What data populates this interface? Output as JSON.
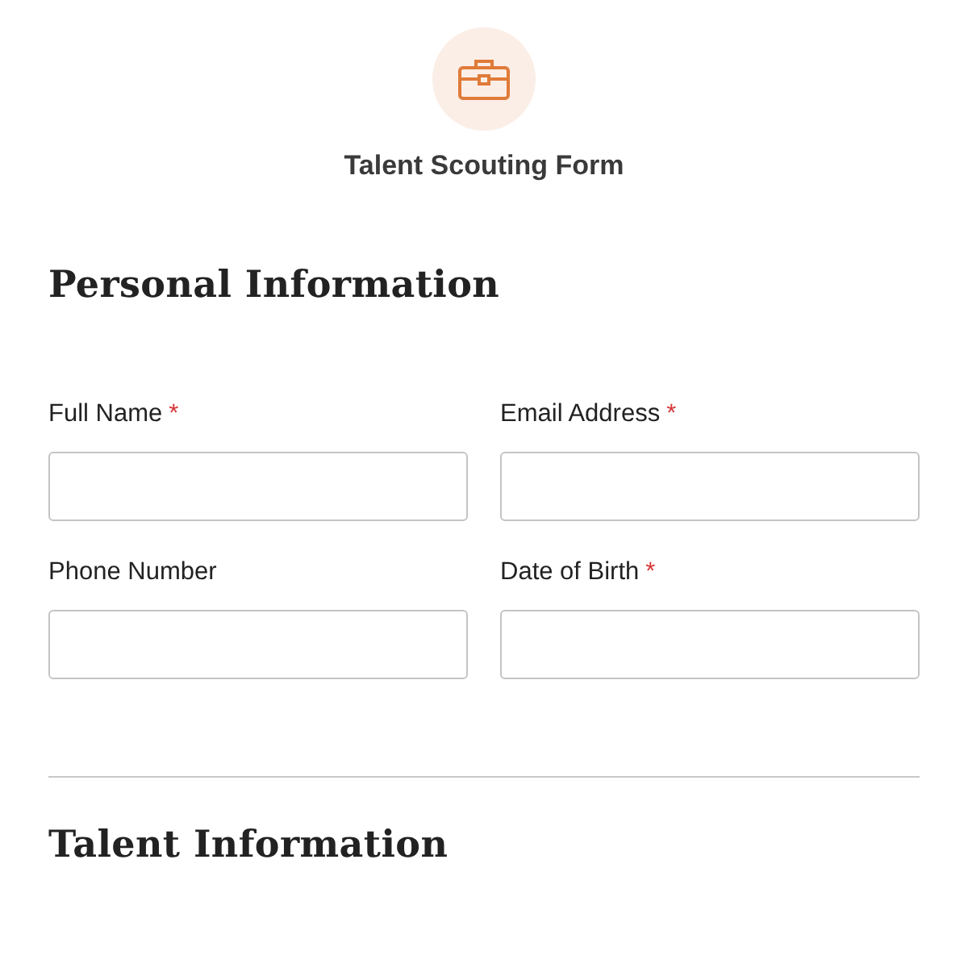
{
  "form": {
    "title": "Talent Scouting Form",
    "required_mark": "*"
  },
  "sections": [
    {
      "heading": "Personal Information",
      "fields": [
        {
          "label": "Full Name",
          "required": true
        },
        {
          "label": "Email Address",
          "required": true
        },
        {
          "label": "Phone Number",
          "required": false
        },
        {
          "label": "Date of Birth",
          "required": true
        }
      ]
    },
    {
      "heading": "Talent Information"
    }
  ]
}
